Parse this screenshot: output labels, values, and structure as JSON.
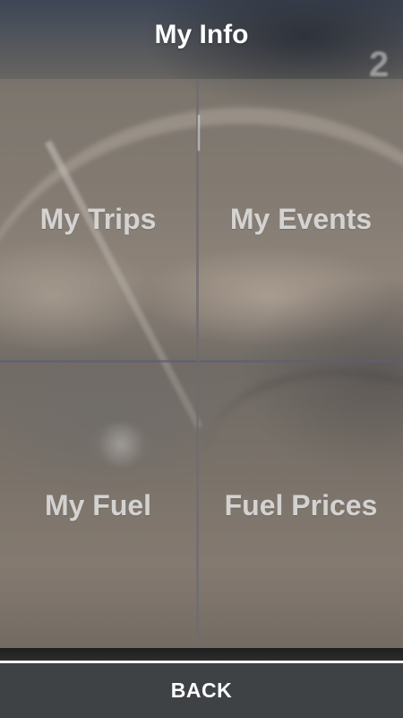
{
  "header": {
    "title": "My Info"
  },
  "background": {
    "dial_digit": "2"
  },
  "tiles": [
    {
      "label": "My Trips"
    },
    {
      "label": "My Events"
    },
    {
      "label": "My Fuel"
    },
    {
      "label": "Fuel Prices"
    }
  ],
  "footer": {
    "back_label": "BACK",
    "bar_color": "#3f4245"
  }
}
